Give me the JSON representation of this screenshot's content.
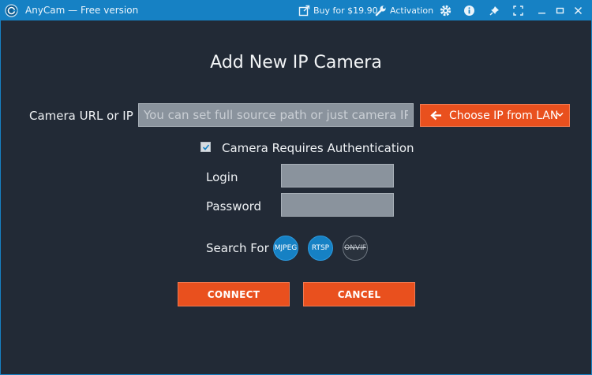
{
  "app": {
    "title": "AnyCam — Free version"
  },
  "titlebar": {
    "buy_label": "Buy for $19.90",
    "activation_label": "Activation",
    "icons": [
      "external-link-icon",
      "wrench-icon",
      "gear-icon",
      "info-icon",
      "pin-icon",
      "fullscreen-icon",
      "minimize-icon",
      "maximize-icon",
      "close-icon"
    ]
  },
  "dialog": {
    "title": "Add New IP Camera",
    "url_label": "Camera URL or IP",
    "url_placeholder": "You can set full source path or just camera IP",
    "url_value": "",
    "lan_button_label": "Choose IP from LAN",
    "auth_label": "Camera Requires Authentication",
    "auth_checked": true,
    "login_label": "Login",
    "login_value": "",
    "password_label": "Password",
    "password_value": "",
    "search_label": "Search For",
    "protocols": [
      {
        "label": "MJPEG",
        "active": true
      },
      {
        "label": "RTSP",
        "active": true
      },
      {
        "label": "ONVIF",
        "active": false
      }
    ],
    "connect_label": "CONNECT",
    "cancel_label": "CANCEL"
  },
  "colors": {
    "background": "#222a36",
    "titlebar": "#1681c4",
    "accent_orange": "#e9501e",
    "protocol_active": "#1681c4"
  }
}
